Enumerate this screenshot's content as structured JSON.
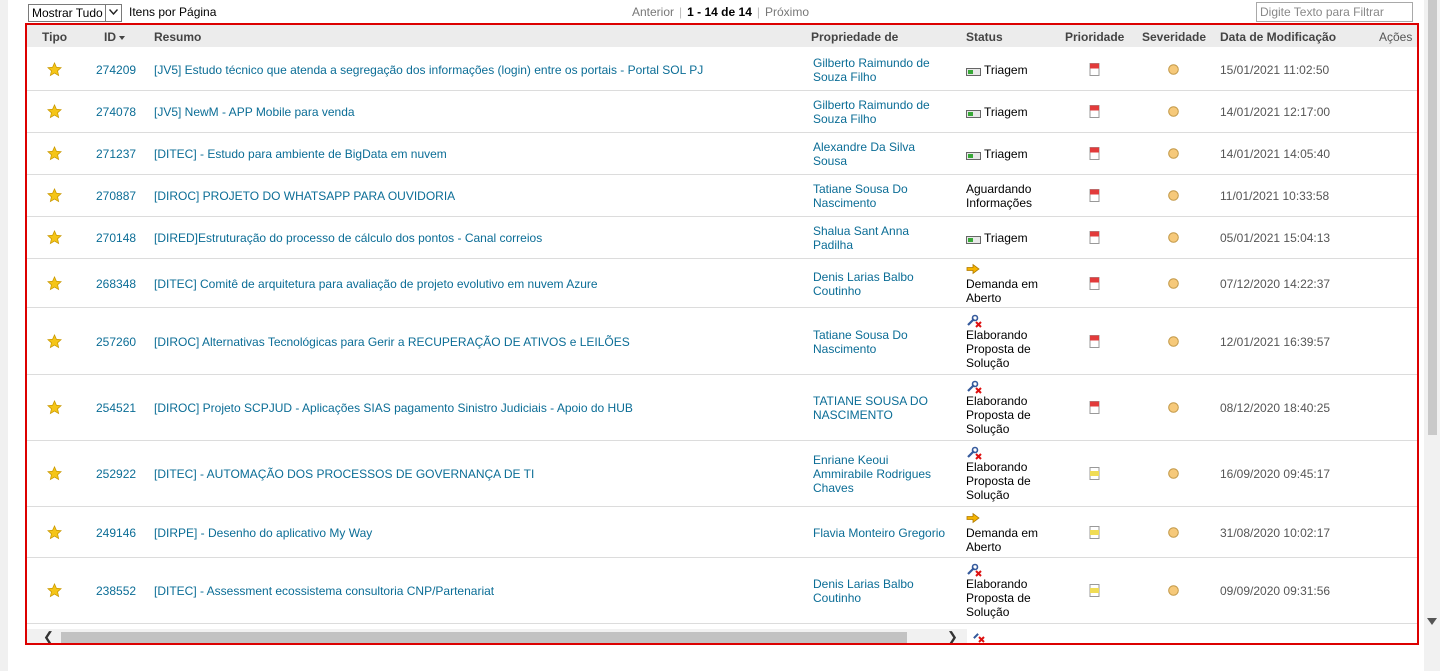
{
  "toolbar": {
    "page_size_selected": "Mostrar Tudo",
    "items_per_page_label": "Itens por Página",
    "pager": {
      "prev": "Anterior",
      "range": "1 - 14 de 14",
      "next": "Próximo"
    },
    "filter_placeholder": "Digite Texto para Filtrar"
  },
  "columns": {
    "type": "Tipo",
    "id": "ID",
    "summary": "Resumo",
    "owner": "Propriedade de",
    "status": "Status",
    "priority": "Prioridade",
    "severity": "Severidade",
    "modified": "Data de Modificação",
    "actions": "Ações"
  },
  "rows": [
    {
      "id": "274209",
      "summary": "[JV5] Estudo técnico que atenda a segregação dos informações (login) entre os portais - Portal SOL PJ",
      "owner_l1": "Gilberto Raimundo de",
      "owner_l2": "Souza Filho",
      "status_icon": "triage-icon",
      "status_l1": "Triagem",
      "status_l2": "",
      "status_l3": "",
      "priority": "high",
      "modified": "15/01/2021 11:02:50"
    },
    {
      "id": "274078",
      "summary": "[JV5] NewM - APP Mobile para venda",
      "owner_l1": "Gilberto Raimundo de",
      "owner_l2": "Souza Filho",
      "status_icon": "triage-icon",
      "status_l1": "Triagem",
      "status_l2": "",
      "status_l3": "",
      "priority": "high",
      "modified": "14/01/2021 12:17:00"
    },
    {
      "id": "271237",
      "summary": "[DITEC] - Estudo para ambiente de BigData em nuvem",
      "owner_l1": "Alexandre Da Silva",
      "owner_l2": "Sousa",
      "status_icon": "triage-icon",
      "status_l1": "Triagem",
      "status_l2": "",
      "status_l3": "",
      "priority": "high",
      "modified": "14/01/2021 14:05:40"
    },
    {
      "id": "270887",
      "summary": "[DIROC] PROJETO DO WHATSAPP PARA OUVIDORIA",
      "owner_l1": "Tatiane Sousa Do",
      "owner_l2": "Nascimento",
      "status_icon": "",
      "status_l1": "Aguardando",
      "status_l2": "Informações",
      "status_l3": "",
      "priority": "high",
      "modified": "11/01/2021 10:33:58"
    },
    {
      "id": "270148",
      "summary": "[DIRED]Estruturação do processo de cálculo dos pontos - Canal correios",
      "owner_l1": "Shalua Sant Anna",
      "owner_l2": "Padilha",
      "status_icon": "triage-icon",
      "status_l1": "Triagem",
      "status_l2": "",
      "status_l3": "",
      "priority": "high",
      "modified": "05/01/2021 15:04:13"
    },
    {
      "id": "268348",
      "summary": "[DITEC] Comitê de arquitetura para avaliação de projeto evolutivo em nuvem Azure",
      "owner_l1": "Denis Larias Balbo",
      "owner_l2": "Coutinho",
      "status_icon": "arrow-right-icon",
      "status_l1": "Demanda em",
      "status_l2": "Aberto",
      "status_l3": "",
      "priority": "high",
      "modified": "07/12/2020 14:22:37"
    },
    {
      "id": "257260",
      "summary": "[DIROC] Alternativas Tecnológicas para Gerir a RECUPERAÇÃO DE ATIVOS e LEILÕES",
      "owner_l1": "Tatiane Sousa Do",
      "owner_l2": "Nascimento",
      "status_icon": "wrench-icon",
      "status_l1": "Elaborando",
      "status_l2": "Proposta de",
      "status_l3": "Solução",
      "priority": "high",
      "modified": "12/01/2021 16:39:57"
    },
    {
      "id": "254521",
      "summary": "[DIROC] Projeto SCPJUD - Aplicações SIAS pagamento Sinistro Judiciais - Apoio do HUB",
      "owner_l1": "TATIANE SOUSA DO",
      "owner_l2": "NASCIMENTO",
      "status_icon": "wrench-icon",
      "status_l1": "Elaborando",
      "status_l2": "Proposta de",
      "status_l3": "Solução",
      "priority": "high",
      "modified": "08/12/2020 18:40:25"
    },
    {
      "id": "252922",
      "summary": "[DITEC] - AUTOMAÇÃO DOS PROCESSOS DE GOVERNANÇA DE TI",
      "owner_l1": "Enriane Keoui",
      "owner_l2": "Ammirabile Rodrigues",
      "owner_l3": "Chaves",
      "status_icon": "wrench-icon",
      "status_l1": "Elaborando",
      "status_l2": "Proposta de",
      "status_l3": "Solução",
      "priority": "medium",
      "modified": "16/09/2020 09:45:17"
    },
    {
      "id": "249146",
      "summary": "[DIRPE] - Desenho do aplicativo My Way",
      "owner_l1": "Flavia Monteiro Gregorio",
      "owner_l2": "",
      "status_icon": "arrow-right-icon",
      "status_l1": "Demanda em",
      "status_l2": "Aberto",
      "status_l3": "",
      "priority": "medium",
      "modified": "31/08/2020 10:02:17"
    },
    {
      "id": "238552",
      "summary": "[DITEC] - Assessment ecossistema consultoria CNP/Partenariat",
      "owner_l1": "Denis Larias Balbo",
      "owner_l2": "Coutinho",
      "status_icon": "wrench-icon",
      "status_l1": "Elaborando",
      "status_l2": "Proposta de",
      "status_l3": "Solução",
      "priority": "medium",
      "modified": "09/09/2020 09:31:56"
    }
  ],
  "colors": {
    "link": "#0b6d96",
    "frame_border": "#dc0000",
    "star": "#f5c518",
    "priority_high": "#e23b3b",
    "priority_medium": "#f0dc55",
    "severity": "#f6c97a"
  }
}
